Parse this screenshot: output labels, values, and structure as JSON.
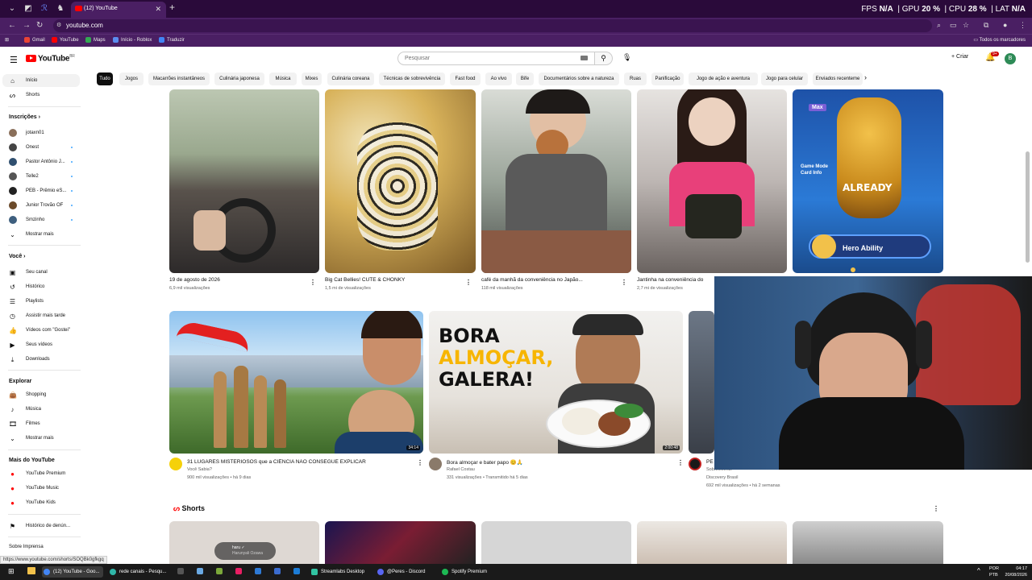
{
  "browser": {
    "active_tab": "(12) YouTube",
    "url": "youtube.com",
    "perf": {
      "fps_label": "FPS",
      "fps": "N/A",
      "gpu_label": "GPU",
      "gpu": "20 %",
      "cpu_label": "CPU",
      "cpu": "28 %",
      "lat_label": "LAT",
      "lat": "N/A"
    },
    "bookmarks": [
      "Gmail",
      "YouTube",
      "Maps",
      "Início - Roblox",
      "Traduzir"
    ],
    "all_bookmarks": "Todos os marcadores"
  },
  "youtube": {
    "logo_text": "YouTube",
    "logo_sup": "BR",
    "search_placeholder": "Pesquisar",
    "create_label": "+ Criar",
    "notif_count": "9+",
    "avatar_letter": "B"
  },
  "sidebar": {
    "home": "Início",
    "shorts": "Shorts",
    "subs_header": "Inscrições",
    "subs": [
      "jotaxn01",
      "Onest",
      "Pastor Antônio J...",
      "Telle2",
      "PEB - Prêmio eS...",
      "Junior Trovão OF",
      "Smzinho"
    ],
    "show_more": "Mostrar mais",
    "you_header": "Você",
    "you_items": [
      "Seu canal",
      "Histórico",
      "Playlists",
      "Assistir mais tarde",
      "Vídeos com \"Gostei\"",
      "Seus vídeos",
      "Downloads"
    ],
    "explore_header": "Explorar",
    "explore_items": [
      "Shopping",
      "Música",
      "Filmes"
    ],
    "show_more2": "Mostrar mais",
    "more_header": "Mais do YouTube",
    "more_items": [
      "YouTube Premium",
      "YouTube Music",
      "YouTube Kids"
    ],
    "report_history": "Histórico de denún...",
    "footer": "Sobre  Imprensa"
  },
  "chips": [
    "Tudo",
    "Jogos",
    "Macarrões instantâneos",
    "Culinária japonesa",
    "Música",
    "Mixes",
    "Culinária coreana",
    "Técnicas de sobrevivência",
    "Fast food",
    "Ao vivo",
    "Bife",
    "Documentários sobre a natureza",
    "Ruas",
    "Panificação",
    "Jogo de ação e aventura",
    "Jogo para celular",
    "Enviados recenteme"
  ],
  "row1": [
    {
      "title": "19 de agosto de 2026",
      "meta": "6,9 mil visualizações"
    },
    {
      "title": "Big Cat Bellies! CUTE & CHONKY",
      "meta": "1,5 mi de visualizações"
    },
    {
      "title": "café da manhã da conveniência no Japão...",
      "meta": "118 mil visualizações"
    },
    {
      "title": "Jantinha na conveniência do",
      "meta": "2,7 mi de visualizações"
    },
    {
      "title": "",
      "meta": ""
    }
  ],
  "row1_overlay": {
    "mode": "Game Mode",
    "card_info": "Card Info",
    "already": "ALREADY",
    "hero_ability": "Hero Ability",
    "max": "Max"
  },
  "row2": [
    {
      "title": "31 LUGARES MISTERIOSOS que a CIÊNCIA NÃO CONSEGUE EXPLICAR",
      "channel": "Você Sabia?",
      "meta": "900 mil visualizações • há 9 dias",
      "duration": "34:14"
    },
    {
      "title": "Bora almoçar e bater papo 😊🙏",
      "channel": "Rafael Costau",
      "meta": "331 visualizações • Transmitido há 5 dias",
      "duration": "2:00:48",
      "thumb_text1": "BORA",
      "thumb_text2": "ALMOÇAR,",
      "thumb_text3": "GALERA!"
    },
    {
      "title": "PE",
      "title2": "Sobrevivente",
      "channel": "Discovery Brasil",
      "meta": "692 mil visualizações • há 2 semanas"
    }
  ],
  "shorts_header": "Shorts",
  "shorts_overlay": {
    "name": "haru",
    "sub": "Harunyali Ozawa"
  },
  "status_url": "https://www.youtube.com/shorts/SOQBk0gfkgq",
  "taskbar": {
    "apps": [
      "(12) YouTube - Goo...",
      "rede canais - Pesqu...",
      "Streamlabs Desktop",
      "@Peres - Discord",
      "Spotify Premium"
    ],
    "lang1": "POR",
    "lang2": "PTB",
    "time": "04:17",
    "date": "20/08/2026"
  }
}
